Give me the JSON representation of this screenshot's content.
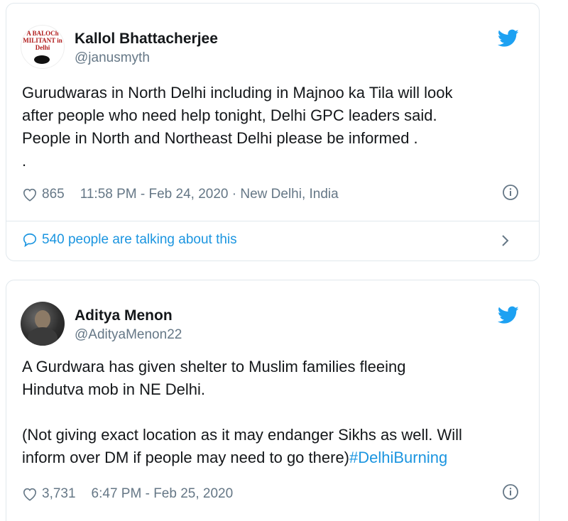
{
  "tweets": [
    {
      "avatar_text": "A BALOCh MILITANT in Delhi",
      "name": "Kallol Bhattacherjee",
      "handle": "@janusmyth",
      "text": "Gurudwaras in North Delhi including in Majnoo ka Tila will look\nafter people who need help tonight, Delhi GPC leaders said.\nPeople in North and Northeast Delhi please be informed .\n.",
      "likes": "865",
      "timestamp": "11:58 PM - Feb 24, 2020 · New Delhi, India",
      "talking": "540 people are talking about this"
    },
    {
      "name": "Aditya Menon",
      "handle": "@AdityaMenon22",
      "text": "A Gurdwara has given shelter to Muslim families fleeing\nHindutva mob in NE Delhi.\n\n(Not giving exact location as it may endanger Sikhs as well. Will\ninform over DM if people may need to go there)",
      "hashtag": "#DelhiBurning",
      "likes": "3,731",
      "timestamp": "6:47 PM - Feb 25, 2020"
    }
  ],
  "icons": {
    "bird": "twitter-bird-icon",
    "heart": "heart-icon",
    "info": "info-icon",
    "bubble": "comment-bubble-icon",
    "chevron": "chevron-right-icon"
  },
  "colors": {
    "twitter_blue": "#1da1f2",
    "link_blue": "#1b95e0",
    "secondary_text": "#657786",
    "border": "#e1e8ed"
  }
}
